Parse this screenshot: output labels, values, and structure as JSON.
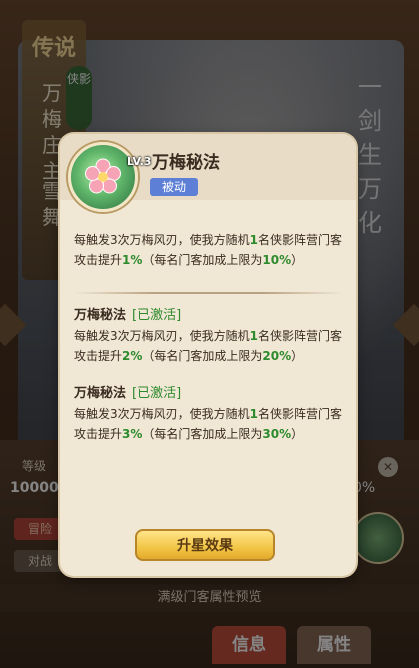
{
  "background": {
    "banner_title": "传说",
    "hero_name_top": "万梅庄主",
    "hero_name_bottom": "雪舞",
    "side_tag": "侠影",
    "poem": "一剑生万化",
    "level_label": "等级",
    "power_value": "10000",
    "percent_suffix": "0%",
    "button_adventure": "冒险",
    "button_battle": "对战",
    "preview_label": "满级门客属性预览",
    "tab_info": "信息",
    "tab_attr": "属性"
  },
  "popup": {
    "skill_level": "LV.3",
    "skill_name": "万梅秘法",
    "skill_type": "被动",
    "description": {
      "part1": "每触发3次万梅风刃，使我方随机",
      "num1": "1",
      "part2": "名侠影阵营门客攻击提升",
      "pct": "1%",
      "part3": "（每名门客加成上限为",
      "cap": "10%",
      "part4": "）"
    },
    "star_effects": [
      {
        "title": "万梅秘法",
        "status": "[已激活]",
        "part1": "每触发3次万梅风刃，使我方随机",
        "num1": "1",
        "part2": "名侠影阵营门客攻击提升",
        "pct": "2%",
        "part3": "（每名门客加成上限为",
        "cap": "20%",
        "part4": "）"
      },
      {
        "title": "万梅秘法",
        "status": "[已激活]",
        "part1": "每触发3次万梅风刃，使我方随机",
        "num1": "1",
        "part2": "名侠影阵营门客攻击提升",
        "pct": "3%",
        "part3": "（每名门客加成上限为",
        "cap": "30%",
        "part4": "）"
      }
    ],
    "upgrade_button": "升星效果"
  },
  "colors": {
    "highlight": "#2d8a2d",
    "type_badge": "#5e7fd6",
    "card_bg": "#f1e7d5"
  }
}
